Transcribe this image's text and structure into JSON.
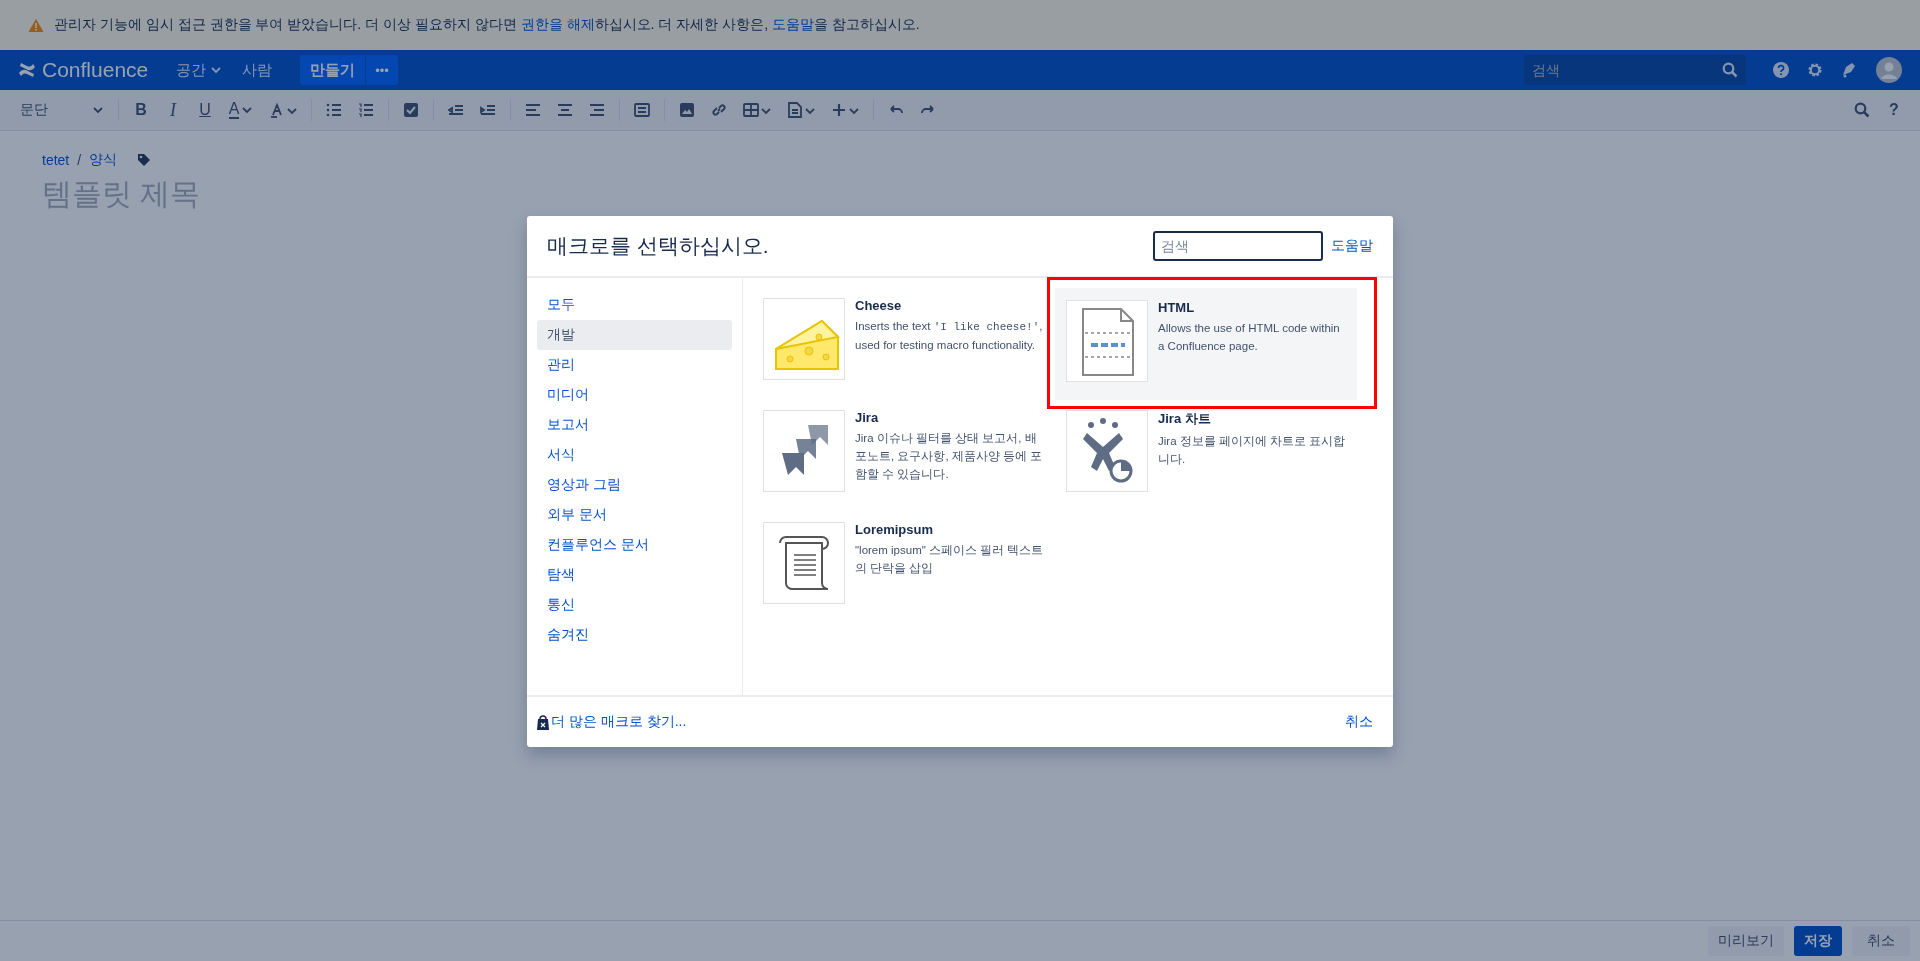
{
  "banner": {
    "parts": [
      {
        "kind": "text",
        "text": "관리자 기능에 임시 접근 권한을 부여 받았습니다. 더 이상 필요하지 않다면 "
      },
      {
        "kind": "link",
        "text": "권한을 해제"
      },
      {
        "kind": "text",
        "text": "하십시오. 더 자세한 사항은, "
      },
      {
        "kind": "link",
        "text": "도움말"
      },
      {
        "kind": "text",
        "text": "을 참고하십시오."
      }
    ]
  },
  "nav": {
    "logo": "Confluence",
    "items": [
      {
        "label": "공간",
        "dropdown": true
      },
      {
        "label": "사람",
        "dropdown": false
      }
    ],
    "create": "만들기",
    "more": "•••",
    "search": {
      "placeholder": "검색"
    }
  },
  "toolbar": {
    "style_dropdown": "문단",
    "format_buttons": [
      "B",
      "I",
      "U"
    ],
    "text_color": "A",
    "help": "?"
  },
  "page": {
    "breadcrumbs": [
      "tetet",
      "양식"
    ],
    "breadcrumb_separator": "/",
    "title": {
      "placeholder": "템플릿 제목"
    }
  },
  "dialog": {
    "title": "매크로를 선택하십시오.",
    "search": {
      "placeholder": "검색"
    },
    "help": "도움말",
    "categories": [
      {
        "label": "모두",
        "selected": false
      },
      {
        "label": "개발",
        "selected": true
      },
      {
        "label": "관리",
        "selected": false
      },
      {
        "label": "미디어",
        "selected": false
      },
      {
        "label": "보고서",
        "selected": false
      },
      {
        "label": "서식",
        "selected": false
      },
      {
        "label": "영상과 그림",
        "selected": false
      },
      {
        "label": "외부 문서",
        "selected": false
      },
      {
        "label": "컨플루언스 문서",
        "selected": false
      },
      {
        "label": "탐색",
        "selected": false
      },
      {
        "label": "통신",
        "selected": false
      },
      {
        "label": "숨겨진",
        "selected": false
      }
    ],
    "macros": [
      {
        "name": "Cheese",
        "description": [
          {
            "kind": "text",
            "text": "Inserts the text "
          },
          {
            "kind": "code",
            "text": "'I like cheese!'"
          },
          {
            "kind": "text",
            "text": ", used for testing macro functionality."
          }
        ],
        "selected": false,
        "highlighted": false
      },
      {
        "name": "HTML",
        "description": [
          {
            "kind": "text",
            "text": "Allows the use of HTML code within a Confluence page."
          }
        ],
        "selected": true,
        "highlighted": true
      },
      {
        "name": "Jira",
        "description": [
          {
            "kind": "text",
            "text": "Jira 이슈나 필터를 상태 보고서, 배포노트, 요구사항, 제품사양 등에 포함할 수 있습니다."
          }
        ],
        "selected": false,
        "highlighted": false
      },
      {
        "name": "Jira 차트",
        "description": [
          {
            "kind": "text",
            "text": "Jira 정보를 페이지에 차트로 표시합니다."
          }
        ],
        "selected": false,
        "highlighted": false
      },
      {
        "name": "Loremipsum",
        "description": [
          {
            "kind": "text",
            "text": "\"lorem ipsum\" 스페이스 필러 텍스트의 단락을 삽입"
          }
        ],
        "selected": false,
        "highlighted": false
      }
    ],
    "footer_link": "더 많은 매크로 찾기...",
    "cancel": "취소"
  },
  "footer_buttons": [
    {
      "label": "미리보기",
      "kind": "secondary"
    },
    {
      "label": "저장",
      "kind": "primary"
    },
    {
      "label": "취소",
      "kind": "subtle"
    }
  ]
}
